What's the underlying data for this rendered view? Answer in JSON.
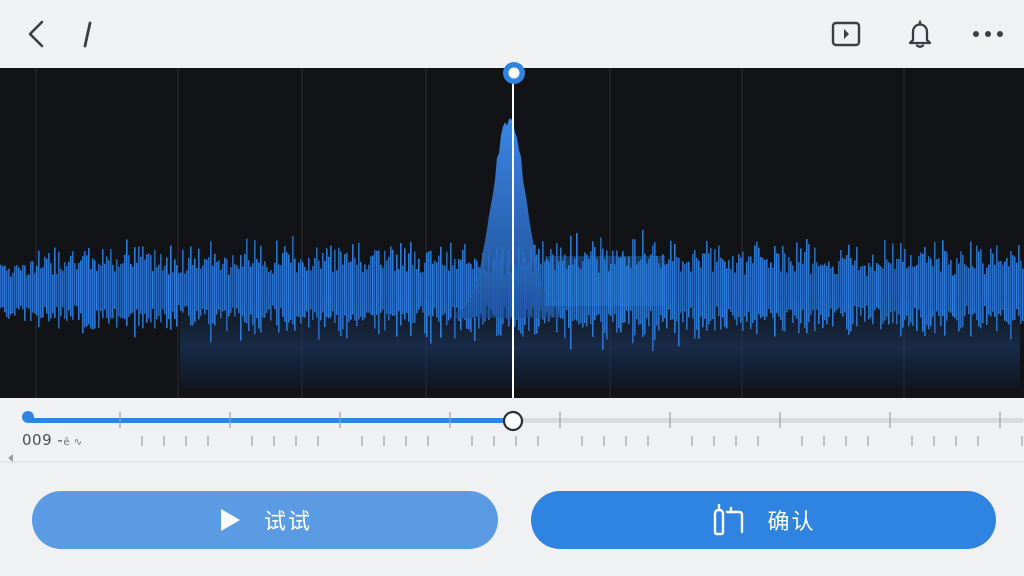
{
  "header": {
    "back_icon": "chevron-left-icon",
    "edit_icon": "pen-icon",
    "media_icon": "media-play-icon",
    "bell_icon": "bell-icon",
    "more_icon": "more-horizontal-icon"
  },
  "player": {
    "time_main": "009 -",
    "time_small": "ē ∿",
    "progress": 0.5,
    "accent": "#2f84e2"
  },
  "actions": {
    "try_label": "试试",
    "try_icon": "play-icon",
    "confirm_label": "确认",
    "confirm_icon": "hand-icon"
  },
  "colors": {
    "wave": "#2f80e0",
    "background": "#121316",
    "page": "#f0f1f3"
  }
}
